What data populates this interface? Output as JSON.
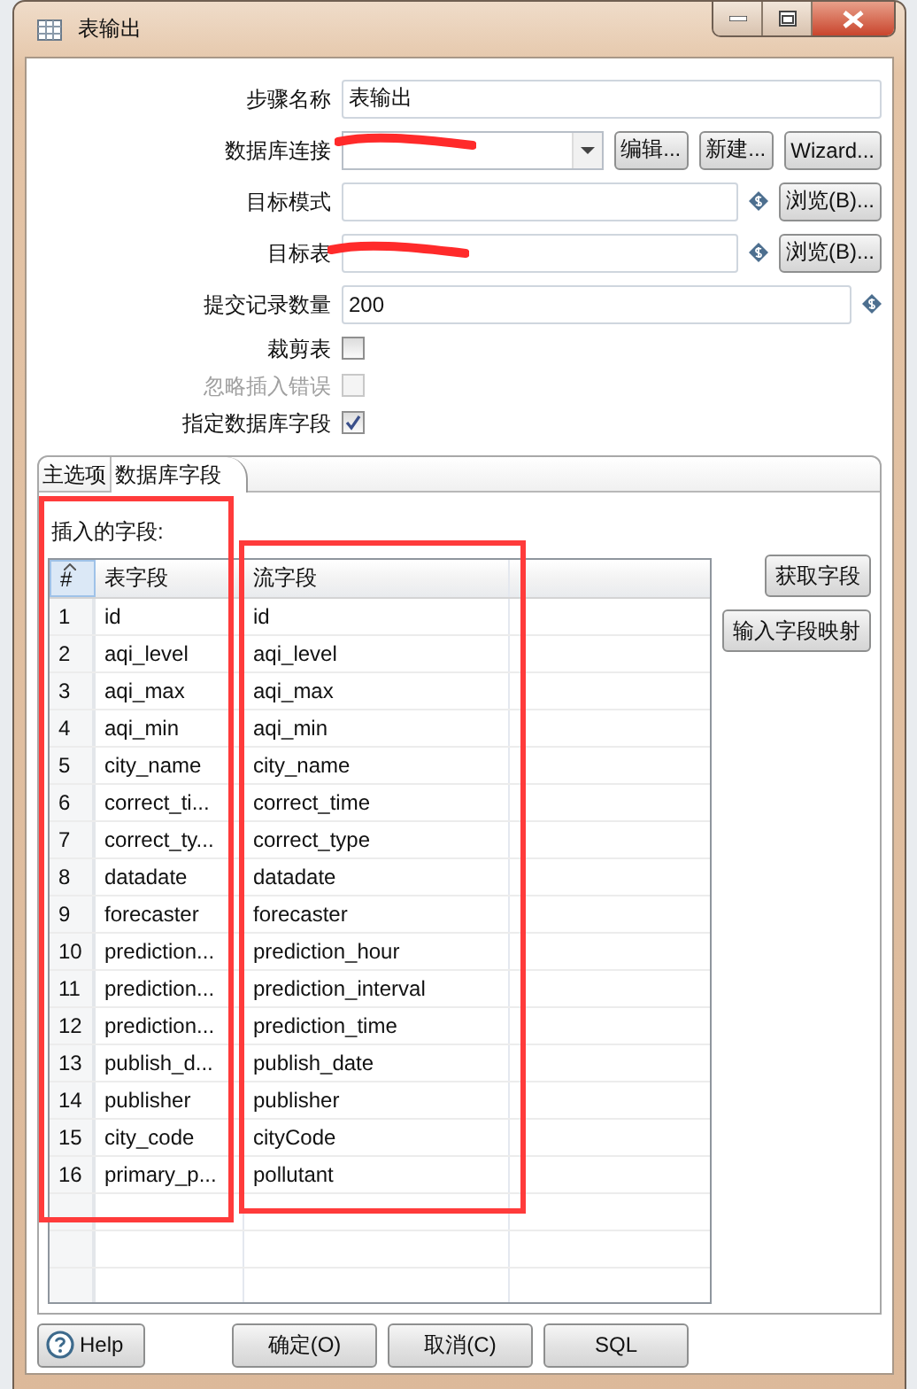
{
  "window": {
    "title": "表输出"
  },
  "form": [
    {
      "kind": "text",
      "label": "步骤名称",
      "value": "表输出",
      "variable": false,
      "redacted": false
    },
    {
      "kind": "combo",
      "label": "数据库连接",
      "variable": false,
      "redacted": true,
      "buttons": [
        "编辑...",
        "新建...",
        "Wizard..."
      ]
    },
    {
      "kind": "text",
      "label": "目标模式",
      "variable": true,
      "redacted": false,
      "buttons": [
        "浏览(B)..."
      ]
    },
    {
      "kind": "text",
      "label": "目标表",
      "variable": true,
      "redacted": true,
      "buttons": [
        "浏览(B)..."
      ]
    },
    {
      "kind": "text",
      "label": "提交记录数量",
      "value": "200",
      "variable": true,
      "redacted": false
    },
    {
      "kind": "checkbox",
      "label": "裁剪表",
      "checked": false,
      "disabled": false
    },
    {
      "kind": "checkbox",
      "label": "忽略插入错误",
      "checked": false,
      "disabled": true
    },
    {
      "kind": "checkbox",
      "label": "指定数据库字段",
      "checked": true,
      "disabled": false
    }
  ],
  "tabs": [
    {
      "label": "主选项",
      "selected": false
    },
    {
      "label": "数据库字段",
      "selected": true
    }
  ],
  "fields_panel": {
    "title": "插入的字段:",
    "table": {
      "columns": [
        "#",
        "表字段",
        "流字段"
      ],
      "rows": [
        [
          "1",
          "id",
          "id"
        ],
        [
          "2",
          "aqi_level",
          "aqi_level"
        ],
        [
          "3",
          "aqi_max",
          "aqi_max"
        ],
        [
          "4",
          "aqi_min",
          "aqi_min"
        ],
        [
          "5",
          "city_name",
          "city_name"
        ],
        [
          "6",
          "correct_ti...",
          "correct_time"
        ],
        [
          "7",
          "correct_ty...",
          "correct_type"
        ],
        [
          "8",
          "datadate",
          "datadate"
        ],
        [
          "9",
          "forecaster",
          "forecaster"
        ],
        [
          "10",
          "prediction...",
          "prediction_hour"
        ],
        [
          "11",
          "prediction...",
          "prediction_interval"
        ],
        [
          "12",
          "prediction...",
          "prediction_time"
        ],
        [
          "13",
          "publish_d...",
          "publish_date"
        ],
        [
          "14",
          "publisher",
          "publisher"
        ],
        [
          "15",
          "city_code",
          "cityCode"
        ],
        [
          "16",
          "primary_p...",
          "pollutant"
        ]
      ]
    },
    "buttons": [
      "获取字段",
      "输入字段映射"
    ]
  },
  "footer": {
    "help": "Help",
    "buttons": [
      "确定(O)",
      "取消(C)",
      "SQL"
    ]
  },
  "annotations": [
    {
      "kind": "red-box"
    },
    {
      "kind": "red-box"
    }
  ]
}
